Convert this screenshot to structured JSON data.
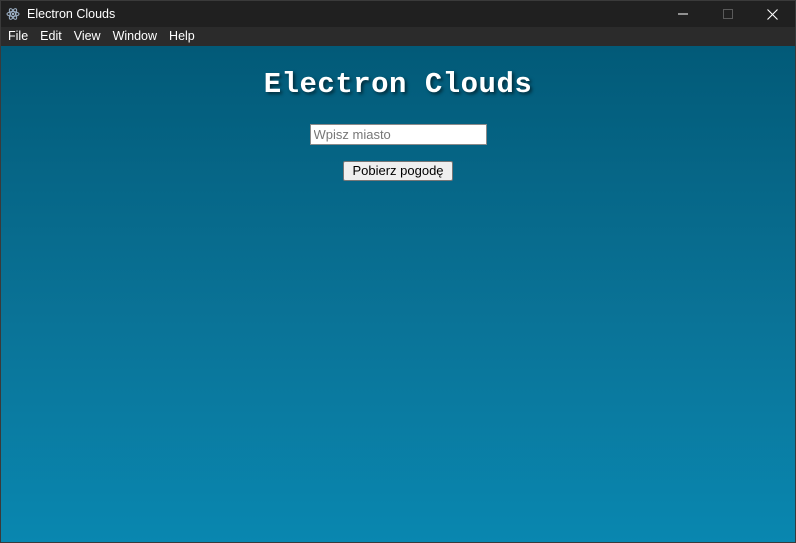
{
  "window": {
    "title": "Electron Clouds",
    "controls": {
      "minimize_icon": "minimize-icon",
      "maximize_icon": "maximize-icon",
      "close_icon": "close-icon"
    }
  },
  "menubar": {
    "items": [
      "File",
      "Edit",
      "View",
      "Window",
      "Help"
    ]
  },
  "main": {
    "heading": "Electron Clouds",
    "city_input": {
      "placeholder": "Wpisz miasto",
      "value": ""
    },
    "fetch_button_label": "Pobierz pogodę"
  },
  "colors": {
    "titlebar_bg": "#202020",
    "menubar_bg": "#2b2b2b",
    "content_gradient_top": "#025a78",
    "content_gradient_bottom": "#0987b0",
    "heading_text": "#ffffff"
  }
}
